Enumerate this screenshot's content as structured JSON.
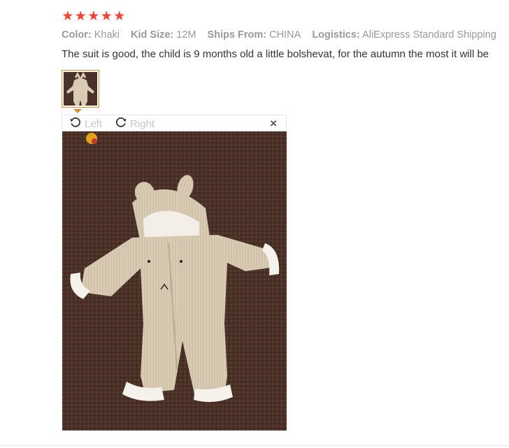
{
  "review": {
    "star_glyph": "★",
    "rating": 5,
    "attributes": [
      {
        "label": "Color:",
        "value": "Khaki"
      },
      {
        "label": "Kid Size:",
        "value": "12M"
      },
      {
        "label": "Ships From:",
        "value": "CHINA"
      },
      {
        "label": "Logistics:",
        "value": "AliExpress Standard Shipping"
      }
    ],
    "text": "The suit is good, the child is 9 months old a little bolshevat, for the autumn the most it will be"
  },
  "viewer": {
    "rotate_left_label": "Left",
    "rotate_right_label": "Right",
    "close_glyph": "×"
  },
  "colors": {
    "star": "#f44336",
    "accent": "#e08a2e",
    "carpet": "#4b3228",
    "suit": "#d9cbb5"
  },
  "icons": [
    "star-icon",
    "rotate-left-icon",
    "rotate-right-icon",
    "close-icon"
  ]
}
